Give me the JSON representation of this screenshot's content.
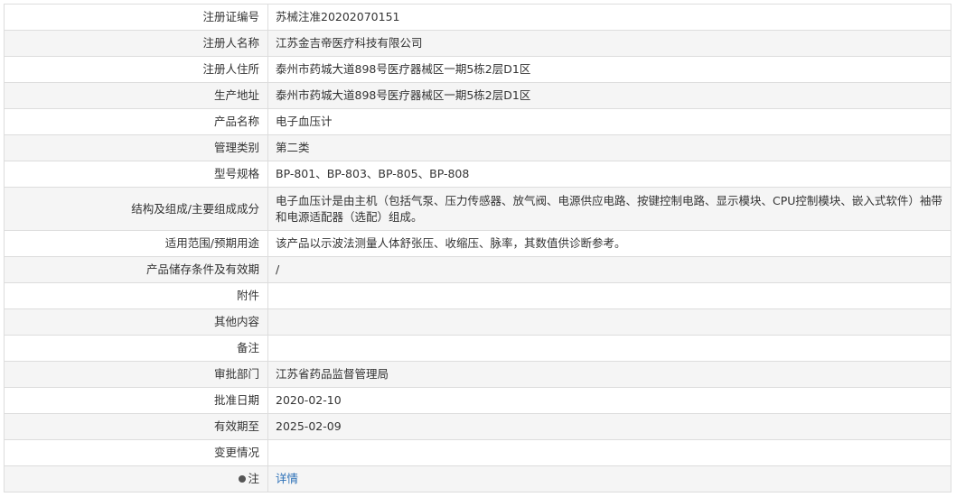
{
  "rows": [
    {
      "label": "注册证编号",
      "value": "苏械注准20202070151"
    },
    {
      "label": "注册人名称",
      "value": "江苏金吉帝医疗科技有限公司"
    },
    {
      "label": "注册人住所",
      "value": "泰州市药城大道898号医疗器械区一期5栋2层D1区"
    },
    {
      "label": "生产地址",
      "value": "泰州市药城大道898号医疗器械区一期5栋2层D1区"
    },
    {
      "label": "产品名称",
      "value": "电子血压计"
    },
    {
      "label": "管理类别",
      "value": "第二类"
    },
    {
      "label": "型号规格",
      "value": "BP-801、BP-803、BP-805、BP-808"
    },
    {
      "label": "结构及组成/主要组成成分",
      "value": "电子血压计是由主机（包括气泵、压力传感器、放气阀、电源供应电路、按键控制电路、显示模块、CPU控制模块、嵌入式软件）袖带和电源适配器（选配）组成。"
    },
    {
      "label": "适用范围/预期用途",
      "value": "该产品以示波法测量人体舒张压、收缩压、脉率，其数值供诊断参考。"
    },
    {
      "label": "产品储存条件及有效期",
      "value": "/"
    },
    {
      "label": "附件",
      "value": ""
    },
    {
      "label": "其他内容",
      "value": ""
    },
    {
      "label": "备注",
      "value": ""
    },
    {
      "label": "审批部门",
      "value": "江苏省药品监督管理局"
    },
    {
      "label": "批准日期",
      "value": "2020-02-10"
    },
    {
      "label": "有效期至",
      "value": "2025-02-09"
    },
    {
      "label": "变更情况",
      "value": ""
    }
  ],
  "note_row": {
    "label": "注",
    "icon": "bulb-icon",
    "link_text": "详情"
  }
}
